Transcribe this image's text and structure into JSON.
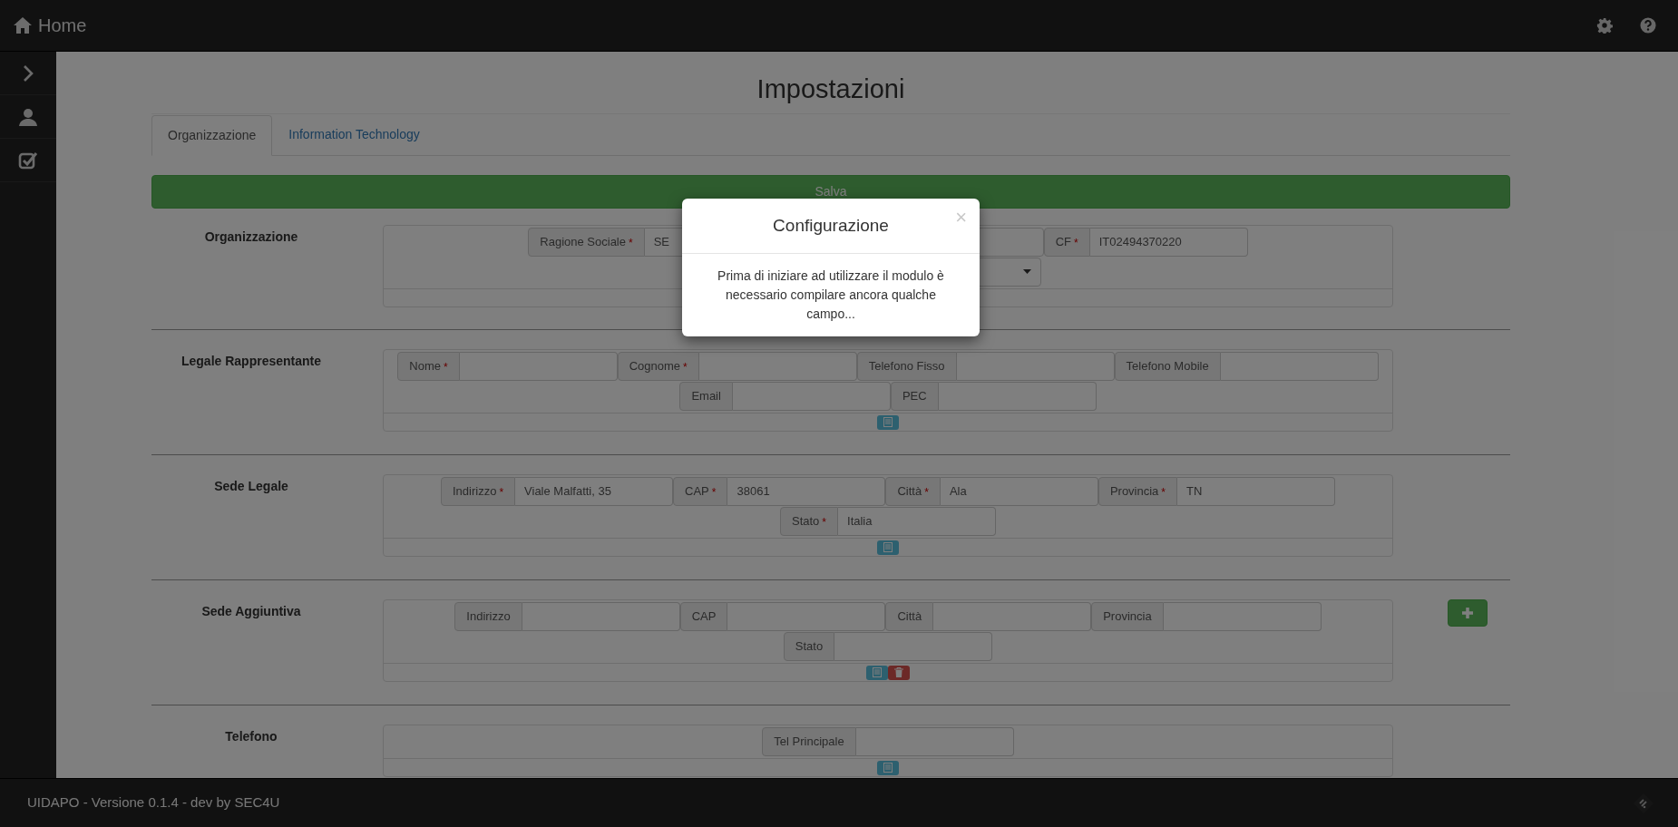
{
  "header": {
    "title": "Home"
  },
  "sidebar": {
    "items": [
      {
        "kind": "expand"
      },
      {
        "kind": "user"
      },
      {
        "kind": "tasks"
      }
    ]
  },
  "page_title": "Impostazioni",
  "tabs": [
    {
      "label": "Organizzazione",
      "selected": true
    },
    {
      "label": "Information Technology",
      "selected": false
    }
  ],
  "save_button": "Salva",
  "sections": [
    {
      "title": "Organizzazione",
      "fields": [
        {
          "kind": "text",
          "label": "Ragione Sociale",
          "mark": "*",
          "value": "SE"
        },
        {
          "kind": "text"
        },
        {
          "kind": "text",
          "label": "CF",
          "mark": "*",
          "value": "IT02494370220"
        },
        {
          "kind": "select"
        }
      ]
    },
    {
      "title": "Legale Rappresentante",
      "fields": [
        {
          "kind": "text",
          "label": "Nome",
          "mark": "*"
        },
        {
          "kind": "text",
          "label": "Cognome",
          "mark": "*"
        },
        {
          "kind": "text",
          "label": "Telefono Fisso"
        },
        {
          "kind": "text",
          "label": "Telefono Mobile"
        },
        {
          "kind": "text",
          "label": "Email"
        },
        {
          "kind": "text",
          "label": "PEC"
        }
      ],
      "actions": [
        {
          "kind": "details"
        }
      ]
    },
    {
      "title": "Sede Legale",
      "fields": [
        {
          "kind": "text",
          "label": "Indirizzo",
          "mark": "*",
          "value": "Viale Malfatti, 35"
        },
        {
          "kind": "text",
          "label": "CAP",
          "mark": "*",
          "value": "38061"
        },
        {
          "kind": "text",
          "label": "Città",
          "mark": "*",
          "value": "Ala"
        },
        {
          "kind": "text",
          "label": "Provincia",
          "mark": "*",
          "value": "TN"
        },
        {
          "kind": "text",
          "label": "Stato",
          "mark": "*",
          "value": "Italia"
        }
      ],
      "actions": [
        {
          "kind": "details"
        }
      ]
    },
    {
      "title": "Sede Aggiuntiva",
      "addable": true,
      "fields": [
        {
          "kind": "text",
          "label": "Indirizzo"
        },
        {
          "kind": "text",
          "label": "CAP"
        },
        {
          "kind": "text",
          "label": "Città"
        },
        {
          "kind": "text",
          "label": "Provincia"
        },
        {
          "kind": "text",
          "label": "Stato"
        }
      ],
      "actions": [
        {
          "kind": "details"
        },
        {
          "kind": "delete"
        }
      ]
    },
    {
      "title": "Telefono",
      "fields": [
        {
          "kind": "text",
          "label": "Tel Principale"
        }
      ],
      "actions": [
        {
          "kind": "details"
        }
      ]
    }
  ],
  "modal": {
    "title": "Configurazione",
    "close": "×",
    "message": "Prima di iniziare ad utilizzare il modulo è necessario compilare ancora qualche campo..."
  },
  "footer": {
    "text": "UIDAPO - Versione 0.1.4 - dev by SEC4U"
  }
}
